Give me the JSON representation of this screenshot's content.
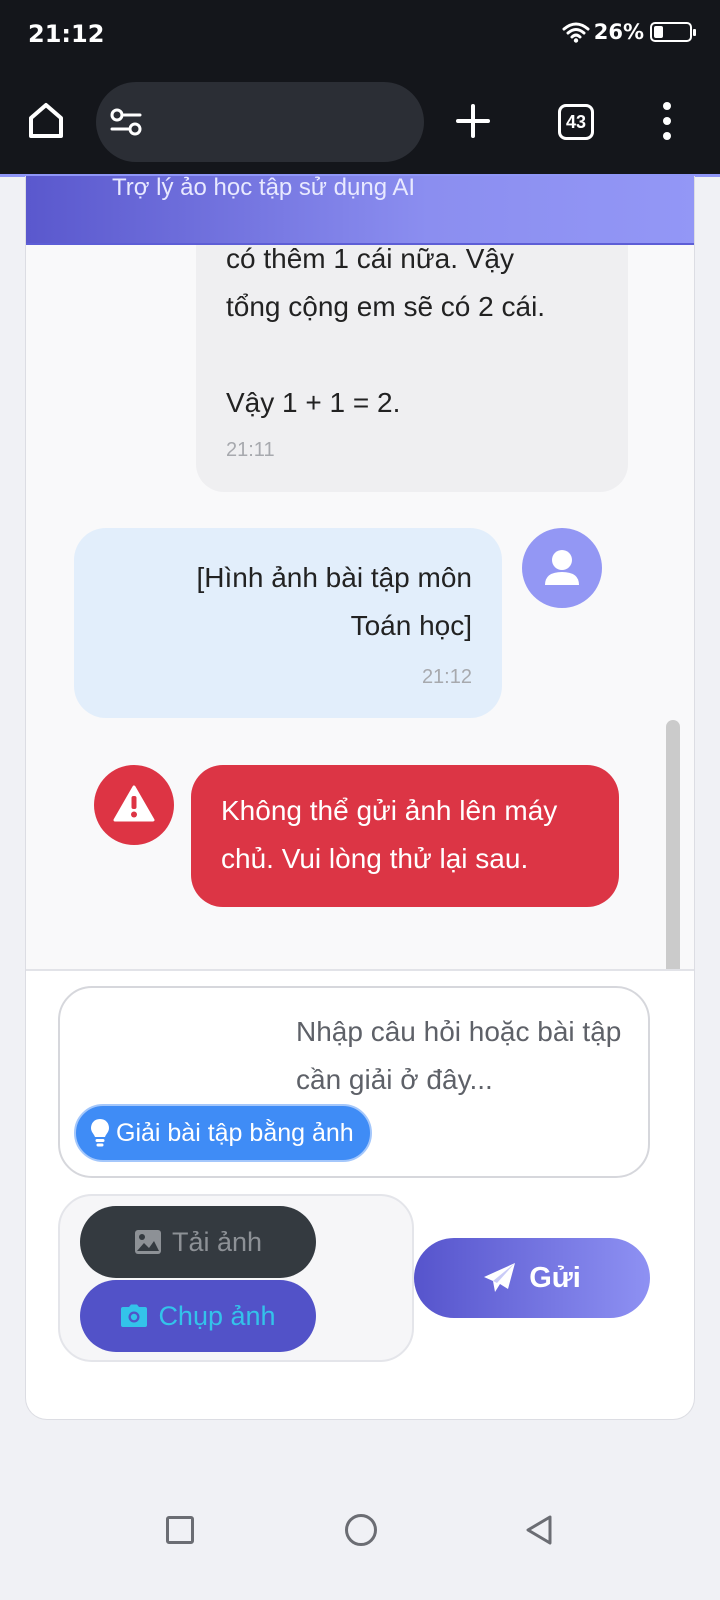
{
  "status_bar": {
    "time": "21:12",
    "battery": "26%",
    "battery_level": 0.26
  },
  "browser": {
    "url_text": "",
    "tab_count": "43"
  },
  "app": {
    "subtitle": "Trợ lý ảo học tập sử dụng AI"
  },
  "messages": {
    "ai": {
      "lines": [
        "có thêm 1 cái nữa. Vậy",
        "tổng cộng em sẽ có 2 cái.",
        "",
        "Vậy 1 + 1 = 2."
      ],
      "time": "21:11"
    },
    "user": {
      "lines": [
        "[Hình ảnh bài tập môn",
        "Toán học]"
      ],
      "time": "21:12"
    },
    "error": {
      "text": "Không thể gửi ảnh lên máy chủ. Vui lòng thử lại sau."
    }
  },
  "input": {
    "placeholder": "Nhập câu hỏi hoặc bài tập cần giải ở đây...",
    "photo_hint": "Giải bài tập bằng ảnh"
  },
  "buttons": {
    "upload": "Tải ảnh",
    "camera": "Chụp ảnh",
    "send": "Gửi"
  },
  "icons": {
    "home": "home-icon",
    "tune": "tune-icon",
    "plus": "plus-icon",
    "menu": "more-vert-icon",
    "avatar": "user-icon",
    "warning": "warning-icon",
    "bulb": "lightbulb-icon",
    "image": "image-icon",
    "camera": "camera-icon",
    "send": "paper-plane-icon"
  },
  "colors": {
    "header_gradient_start": "#5a58cd",
    "header_gradient_end": "#9397f6",
    "error": "#dc3545",
    "user_bubble": "#e2eefb",
    "ai_bubble": "#efeff1",
    "hint_button": "#3f8cf6",
    "upload_button": "#343a40",
    "camera_button": "#5252c8"
  }
}
